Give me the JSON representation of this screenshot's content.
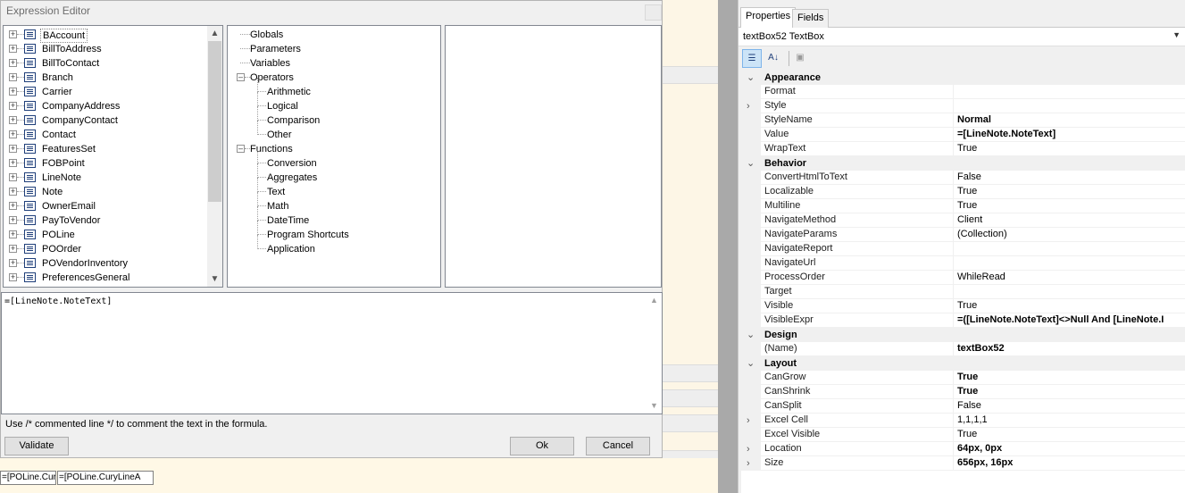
{
  "background": {
    "cells": [
      "=[POLine.Cur",
      "=[POLine.CuryLineA"
    ]
  },
  "dialog": {
    "title": "Expression Editor",
    "entities": [
      {
        "label": "BAccount",
        "selected": true
      },
      {
        "label": "BillToAddress"
      },
      {
        "label": "BillToContact"
      },
      {
        "label": "Branch"
      },
      {
        "label": "Carrier"
      },
      {
        "label": "CompanyAddress"
      },
      {
        "label": "CompanyContact"
      },
      {
        "label": "Contact"
      },
      {
        "label": "FeaturesSet"
      },
      {
        "label": "FOBPoint"
      },
      {
        "label": "LineNote"
      },
      {
        "label": "Note"
      },
      {
        "label": "OwnerEmail"
      },
      {
        "label": "PayToVendor"
      },
      {
        "label": "POLine"
      },
      {
        "label": "POOrder"
      },
      {
        "label": "POVendorInventory"
      },
      {
        "label": "PreferencesGeneral"
      }
    ],
    "functions": [
      {
        "label": "Globals",
        "level": 0
      },
      {
        "label": "Parameters",
        "level": 0
      },
      {
        "label": "Variables",
        "level": 0
      },
      {
        "label": "Operators",
        "level": 0,
        "expanded": true
      },
      {
        "label": "Arithmetic",
        "level": 1
      },
      {
        "label": "Logical",
        "level": 1
      },
      {
        "label": "Comparison",
        "level": 1
      },
      {
        "label": "Other",
        "level": 1
      },
      {
        "label": "Functions",
        "level": 0,
        "expanded": true
      },
      {
        "label": "Conversion",
        "level": 1
      },
      {
        "label": "Aggregates",
        "level": 1
      },
      {
        "label": "Text",
        "level": 1
      },
      {
        "label": "Math",
        "level": 1
      },
      {
        "label": "DateTime",
        "level": 1
      },
      {
        "label": "Program Shortcuts",
        "level": 1
      },
      {
        "label": "Application",
        "level": 1
      }
    ],
    "formula": "=[LineNote.NoteText]",
    "hint": "Use /* commented line */ to comment the text in the formula.",
    "validate_label": "Validate",
    "ok_label": "Ok",
    "cancel_label": "Cancel"
  },
  "properties": {
    "tabs": [
      "Properties",
      "Fields"
    ],
    "active_tab": "Properties",
    "object_selector": "textBox52  TextBox",
    "rows": [
      {
        "type": "category",
        "label": "Appearance"
      },
      {
        "name": "Format",
        "value": ""
      },
      {
        "name": "Style",
        "value": "",
        "expandable": true
      },
      {
        "name": "StyleName",
        "value": "Normal",
        "bold": true
      },
      {
        "name": "Value",
        "value": "=[LineNote.NoteText]",
        "bold": true
      },
      {
        "name": "WrapText",
        "value": "True"
      },
      {
        "type": "category",
        "label": "Behavior"
      },
      {
        "name": "ConvertHtmlToText",
        "value": "False"
      },
      {
        "name": "Localizable",
        "value": "True"
      },
      {
        "name": "Multiline",
        "value": "True"
      },
      {
        "name": "NavigateMethod",
        "value": "Client"
      },
      {
        "name": "NavigateParams",
        "value": "(Collection)"
      },
      {
        "name": "NavigateReport",
        "value": ""
      },
      {
        "name": "NavigateUrl",
        "value": ""
      },
      {
        "name": "ProcessOrder",
        "value": "WhileRead"
      },
      {
        "name": "Target",
        "value": ""
      },
      {
        "name": "Visible",
        "value": "True"
      },
      {
        "name": "VisibleExpr",
        "value": "=([LineNote.NoteText]<>Null And [LineNote.I",
        "bold": true
      },
      {
        "type": "category",
        "label": "Design"
      },
      {
        "name": "(Name)",
        "value": "textBox52",
        "bold": true
      },
      {
        "type": "category",
        "label": "Layout"
      },
      {
        "name": "CanGrow",
        "value": "True",
        "bold": true
      },
      {
        "name": "CanShrink",
        "value": "True",
        "bold": true
      },
      {
        "name": "CanSplit",
        "value": "False"
      },
      {
        "name": "Excel Cell",
        "value": "1,1,1,1",
        "expandable": true
      },
      {
        "name": "Excel Visible",
        "value": "True"
      },
      {
        "name": "Location",
        "value": "64px, 0px",
        "bold": true,
        "expandable": true
      },
      {
        "name": "Size",
        "value": "656px, 16px",
        "bold": true,
        "expandable": true
      }
    ]
  }
}
